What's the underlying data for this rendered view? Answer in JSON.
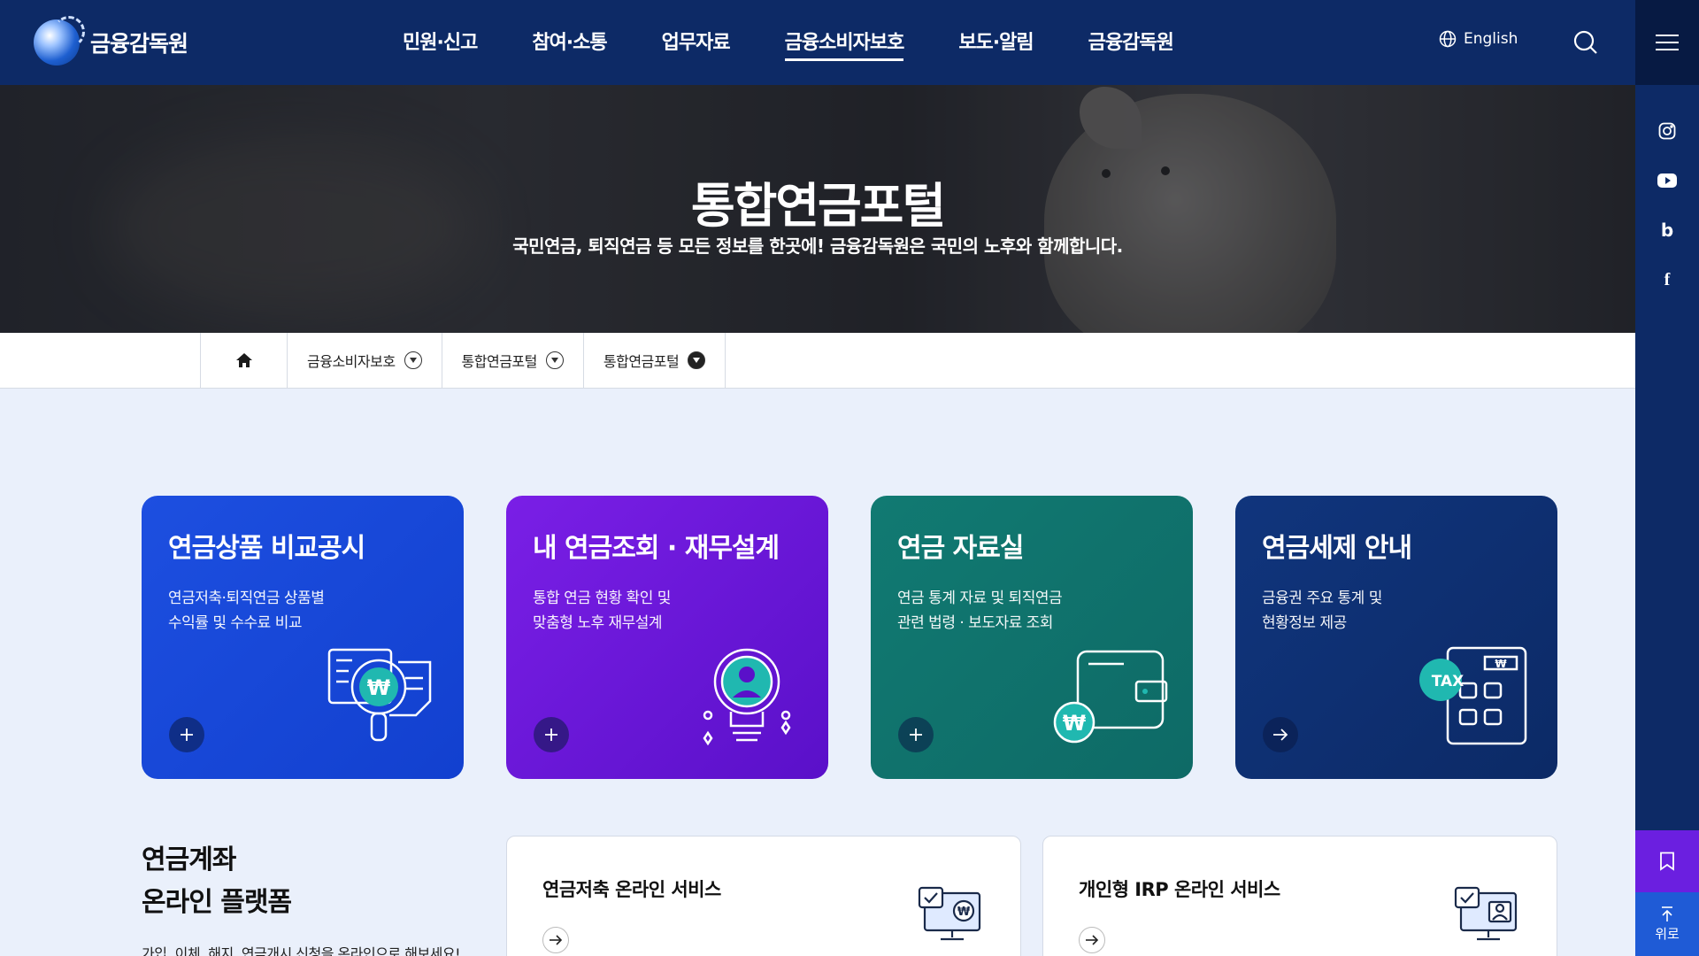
{
  "header": {
    "logo_text": "금융감독원",
    "nav": [
      "민원·신고",
      "참여·소통",
      "업무자료",
      "금융소비자보호",
      "보도·알림",
      "금융감독원"
    ],
    "active_nav_index": 3,
    "language_label": "English"
  },
  "hero": {
    "title": "통합연금포털",
    "subtitle": "국민연금, 퇴직연금 등 모든 정보를 한곳에! 금융감독원은 국민의 노후와 함께합니다."
  },
  "breadcrumb": [
    "금융소비자보호",
    "통합연금포털",
    "통합연금포털"
  ],
  "cards": [
    {
      "title": "연금상품 비교공시",
      "desc_line1": "연금저축·퇴직연금 상품별",
      "desc_line2": "수익률 및 수수료 비교",
      "button": "plus",
      "illustration": "document-won-magnifier-icon"
    },
    {
      "title": "내 연금조회 · 재무설계",
      "desc_line1": "통합 연금 현황 확인 및",
      "desc_line2": "맞춤형 노후 재무설계",
      "button": "plus",
      "illustration": "lightbulb-person-icon"
    },
    {
      "title": "연금 자료실",
      "desc_line1": "연금 통계 자료 및 퇴직연금",
      "desc_line2": "관련 법령 · 보도자료 조회",
      "button": "plus",
      "illustration": "wallet-won-icon"
    },
    {
      "title": "연금세제 안내",
      "desc_line1": "금융권 주요 통계 및",
      "desc_line2": "현황정보 제공",
      "button": "arrow",
      "illustration": "tax-calculator-icon",
      "badge": "TAX"
    }
  ],
  "section": {
    "title_line1": "연금계좌",
    "title_line2": "온라인 플랫폼",
    "desc": "가입, 이체, 해지, 연금개시 신청을 온라인으로 해보세요!"
  },
  "services": [
    {
      "title": "연금저축 온라인 서비스",
      "illustration": "monitor-won-check-icon"
    },
    {
      "title": "개인형 IRP 온라인 서비스",
      "illustration": "monitor-person-check-icon"
    }
  ],
  "rail": {
    "socials": [
      "instagram-icon",
      "youtube-icon",
      "blog-icon",
      "facebook-icon"
    ],
    "blog_glyph": "b",
    "facebook_glyph": "f",
    "top_label": "위로"
  },
  "colors": {
    "header_bg": "#0d2a66",
    "card1": "#1d4fe0",
    "card2": "#7a1fe6",
    "card3": "#117a72",
    "card4": "#10357d",
    "accent_teal": "#20b8b0",
    "bookmark_bg": "#6b1fe0",
    "top_bg": "#1f5bd6"
  }
}
